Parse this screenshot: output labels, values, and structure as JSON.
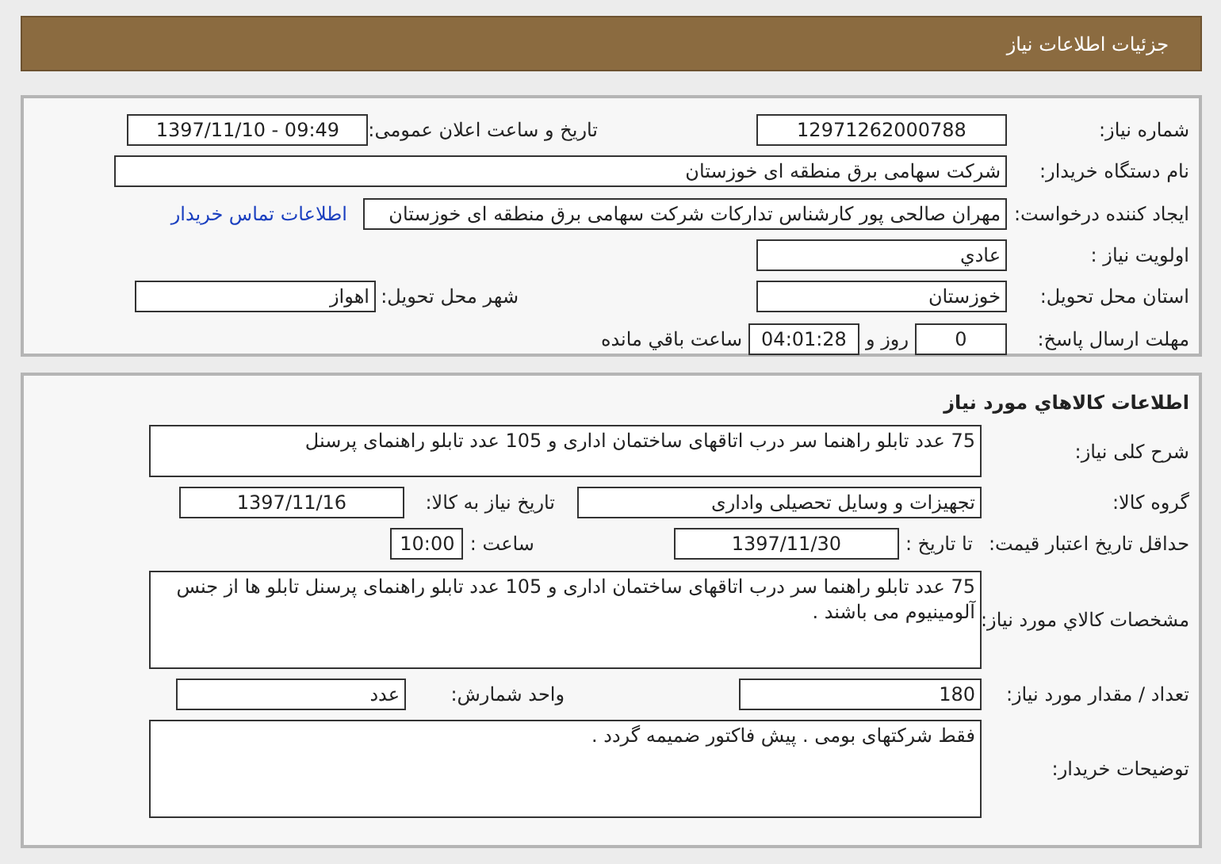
{
  "header": {
    "title": "جزئیات اطلاعات نیاز"
  },
  "summary": {
    "need_number": {
      "label": "شماره نیاز:",
      "value": "12971262000788"
    },
    "announce": {
      "label": "تاریخ و ساعت اعلان عمومی:",
      "value": "1397/11/10 - 09:49"
    },
    "buyer": {
      "label": "نام دستگاه خریدار:",
      "value": "شرکت سهامی برق منطقه ای خوزستان"
    },
    "requester": {
      "label": "ایجاد کننده درخواست:",
      "value": "مهران صالحی پور کارشناس تدارکات شرکت سهامی برق منطقه ای خوزستان",
      "link": "اطلاعات تماس خریدار"
    },
    "priority": {
      "label": "اولویت نیاز :",
      "value": "عادي"
    },
    "province": {
      "label": "استان محل تحویل:",
      "value": "خوزستان"
    },
    "city": {
      "label": "شهر محل تحویل:",
      "value": "اهواز"
    },
    "deadline": {
      "label": "مهلت ارسال پاسخ:",
      "days": "0",
      "days_unit": "روز و",
      "time": "04:01:28",
      "time_suffix": "ساعت باقي مانده"
    }
  },
  "goods": {
    "title": "اطلاعات كالاهاي مورد نياز",
    "description": {
      "label": "شرح کلی نیاز:",
      "value": "75 عدد تابلو راهنما سر درب اتاقهای ساختمان اداری و 105 عدد تابلو راهنمای پرسنل"
    },
    "group": {
      "label": "گروه کالا:",
      "value": "تجهیزات و وسایل تحصیلی واداری"
    },
    "need_date": {
      "label": "تاریخ نیاز به کالا:",
      "value": "1397/11/16"
    },
    "price_validity": {
      "label": "حداقل تاریخ اعتبار قیمت:",
      "date_label": "تا تاریخ :",
      "date": "1397/11/30",
      "time_label": "ساعت :",
      "time": "10:00"
    },
    "specs": {
      "label": "مشخصات كالاي مورد نياز:",
      "value": "75 عدد تابلو راهنما سر درب اتاقهای ساختمان اداری و 105 عدد تابلو راهنمای پرسنل تابلو ها از جنس آلومینیوم می باشند ."
    },
    "quantity": {
      "label": "تعداد / مقدار مورد نیاز:",
      "value": "180"
    },
    "unit": {
      "label": "واحد شمارش:",
      "value": "عدد"
    },
    "notes": {
      "label": "توضیحات خریدار:",
      "value": "فقط شرکتهای بومی . پیش فاکتور  ضمیمه گردد ."
    }
  }
}
